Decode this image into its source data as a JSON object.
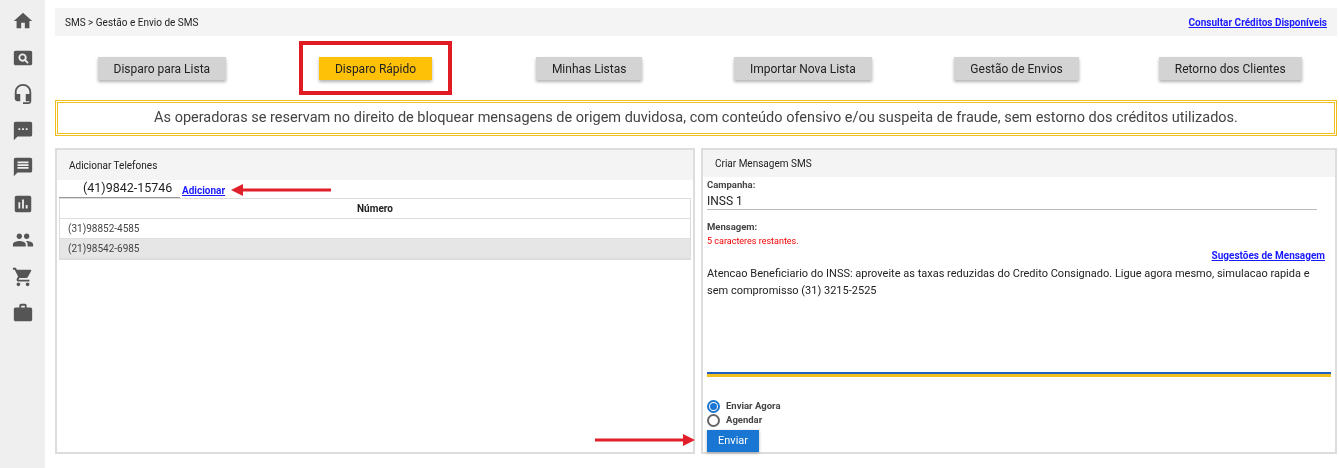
{
  "sidebar": {
    "items": [
      {
        "kind": "home"
      },
      {
        "kind": "search"
      },
      {
        "kind": "headset"
      },
      {
        "kind": "chat"
      },
      {
        "kind": "message"
      },
      {
        "kind": "chart"
      },
      {
        "kind": "people"
      },
      {
        "kind": "cart"
      },
      {
        "kind": "briefcase"
      }
    ]
  },
  "breadcrumb": "SMS > Gestão e Envio de SMS",
  "credits_link": "Consultar Créditos Disponíveis",
  "tabs": [
    {
      "label": "Disparo para Lista",
      "selected": false,
      "highlighted": false
    },
    {
      "label": "Disparo Rápido",
      "selected": true,
      "highlighted": true
    },
    {
      "label": "Minhas Listas",
      "selected": false,
      "highlighted": false
    },
    {
      "label": "Importar Nova Lista",
      "selected": false,
      "highlighted": false
    },
    {
      "label": "Gestão de Envios",
      "selected": false,
      "highlighted": false
    },
    {
      "label": "Retorno dos Clientes",
      "selected": false,
      "highlighted": false
    }
  ],
  "notice": "As operadoras se reservam no direito de bloquear mensagens de origem duvidosa, com conteúdo ofensivo e/ou suspeita de fraude, sem estorno dos créditos utilizados.",
  "phones_panel": {
    "title": "Adicionar Telefones",
    "phone_input": {
      "value": "(41)9842-15746"
    },
    "add_link": "Adicionar",
    "table": {
      "columns": [
        "Número"
      ],
      "rows": [
        {
          "cells": [
            "(31)98852-4585"
          ],
          "selected": false
        },
        {
          "cells": [
            "(21)98542-6985"
          ],
          "selected": true
        }
      ]
    }
  },
  "message_panel": {
    "title": "Criar Mensagem SMS",
    "campaign_label": "Campanha:",
    "campaign_value": "INSS 1",
    "message_label": "Mensagem:",
    "remaining": "5 caracteres restantes.",
    "suggestions_link": "Sugestões de Mensagem",
    "message_value": "Atencao Beneficiario do INSS: aproveite as taxas reduzidas do Credito Consignado. Ligue agora mesmo, simulacao rapida e sem compromisso (31) 3215-2525",
    "schedule_options": [
      {
        "label": "Enviar Agora",
        "selected": true
      },
      {
        "label": "Agendar",
        "selected": false
      }
    ],
    "send_button": "Enviar"
  }
}
